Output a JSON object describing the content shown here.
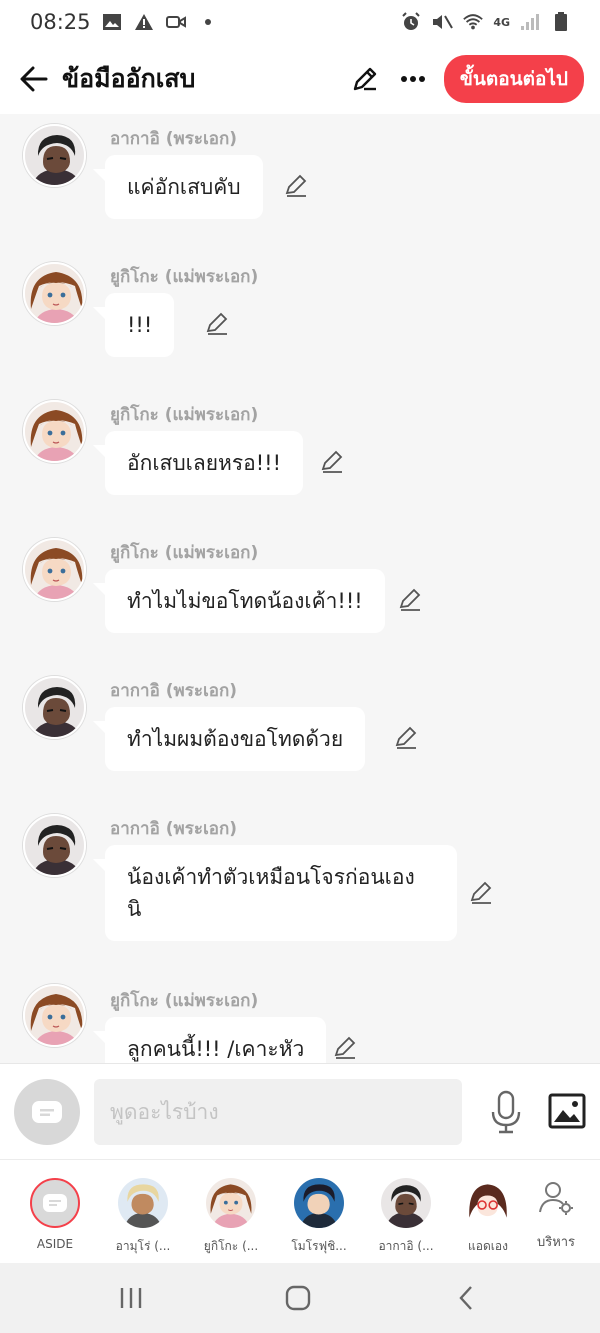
{
  "status_bar": {
    "time": "08:25",
    "network": "4G"
  },
  "header": {
    "title": "ข้อมืออักเสบ",
    "next_label": "ขั้นตอนต่อไป"
  },
  "messages": [
    {
      "sender": "อากาอิ (พระเอก)",
      "text": "แค่อักเสบคับ",
      "avatar": "akai"
    },
    {
      "sender": "ยูกิโกะ (แม่พระเอก)",
      "text": "!!!",
      "avatar": "yukiko"
    },
    {
      "sender": "ยูกิโกะ (แม่พระเอก)",
      "text": "อักเสบเลยหรอ!!!",
      "avatar": "yukiko"
    },
    {
      "sender": "ยูกิโกะ (แม่พระเอก)",
      "text": "ทำไมไม่ขอโทดน้องเค้า!!!",
      "avatar": "yukiko"
    },
    {
      "sender": "อากาอิ (พระเอก)",
      "text": "ทำไมผมต้องขอโทดด้วย",
      "avatar": "akai"
    },
    {
      "sender": "อากาอิ (พระเอก)",
      "text": "น้องเค้าทำตัวเหมือนโจรก่อนเอง นิ",
      "avatar": "akai"
    },
    {
      "sender": "ยูกิโกะ (แม่พระเอก)",
      "text": "ลูกคนนี้!!! /เคาะหัว",
      "avatar": "yukiko"
    }
  ],
  "input": {
    "placeholder": "พูดอะไรบ้าง"
  },
  "characters": [
    {
      "label": "ASIDE"
    },
    {
      "label": "อามุโร่ (..."
    },
    {
      "label": "ยูกิโกะ (..."
    },
    {
      "label": "โมโรฟุชิ..."
    },
    {
      "label": "อากาอิ (..."
    },
    {
      "label": "แอดเอง"
    },
    {
      "label": "บริหาร"
    }
  ],
  "colors": {
    "accent": "#f4404a",
    "sender": "#a3a3a3",
    "background": "#f6f6f6"
  }
}
